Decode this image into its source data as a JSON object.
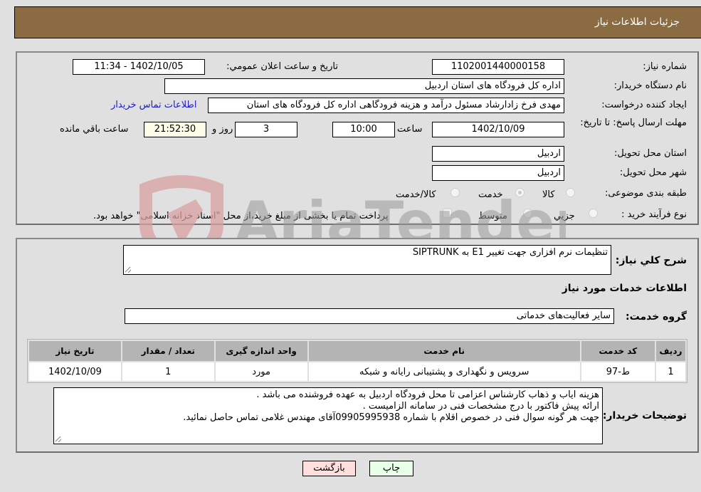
{
  "header": {
    "title": "جزئيات اطلاعات نياز"
  },
  "fields": {
    "need_number_label": "شماره نياز:",
    "need_number": "1102001440000158",
    "announce_label": "تاريخ و ساعت اعلان عمومي:",
    "announce_value": "1402/10/05 - 11:34",
    "buyer_org_label": "نام دستگاه خريدار:",
    "buyer_org": "اداره کل فرودگاه های استان اردبیل",
    "requester_label": "ايجاد کننده درخواست:",
    "requester": "مهدی فرخ زادارشاد مسئول درآمد و هزینه فرودگاهی اداره کل فرودگاه های استان",
    "buyer_contact_link": "اطلاعات تماس خريدار",
    "deadline_label": "مهلت ارسال پاسخ: تا تاريخ:",
    "deadline_date": "1402/10/09",
    "time_label": "ساعت",
    "deadline_time": "10:00",
    "days_value": "3",
    "days_label": "روز و",
    "remaining_time": "21:52:30",
    "remaining_label": "ساعت باقي مانده",
    "province_label": "استان محل تحويل:",
    "province": "اردبیل",
    "city_label": "شهر محل تحويل:",
    "city": "اردبیل",
    "category_label": "طبقه بندی موضوعی:",
    "category_options": [
      {
        "label": "کالا",
        "checked": false
      },
      {
        "label": "خدمت",
        "checked": true
      },
      {
        "label": "کالا/خدمت",
        "checked": false
      }
    ],
    "process_label": "نوع فرآيند خريد :",
    "process_options": [
      {
        "label": "جزيي",
        "checked": false
      },
      {
        "label": "متوسط",
        "checked": false
      }
    ],
    "treasury_note": "پرداخت تمام یا بخشی از مبلغ خرید،از محل \"اسناد خزانه اسلامی\" خواهد بود.",
    "treasury_checked": false
  },
  "details": {
    "description_label": "شرح کلي نياز:",
    "description": "تنظیمات نرم افزاری جهت تغییر E1  به  SIPTRUNK",
    "services_heading": "اطلاعات خدمات مورد نياز",
    "service_group_label": "گروه خدمت:",
    "service_group": "سایر فعالیت‌های خدماتی"
  },
  "table": {
    "headers": [
      "رديف",
      "کد خدمت",
      "نام خدمت",
      "واحد اندازه گيری",
      "تعداد / مقدار",
      "تاريخ نياز"
    ],
    "rows": [
      [
        "1",
        "ط-97",
        "سرویس و نگهداری و پشتیبانی رایانه و شبکه",
        "مورد",
        "1",
        "1402/10/09"
      ]
    ]
  },
  "buyer_notes": {
    "label": "توضيحات خريدار:",
    "lines": [
      "هزینه ایاب و ذهاب کارشناس اعزامی تا محل فرودگاه اردبیل به عهده فروشنده می باشد .",
      "ارائه پیش فاکتور با درج مشخصات فنی در سامانه الزامیست .",
      "جهت هر گونه سوال فنی در خصوص اقلام با شماره 09905995938آقای مهندس غلامی تماس حاصل نمائید."
    ]
  },
  "buttons": {
    "print": "چاپ",
    "back": "بازگشت"
  },
  "watermark": {
    "text": "AriaTender.neT"
  }
}
